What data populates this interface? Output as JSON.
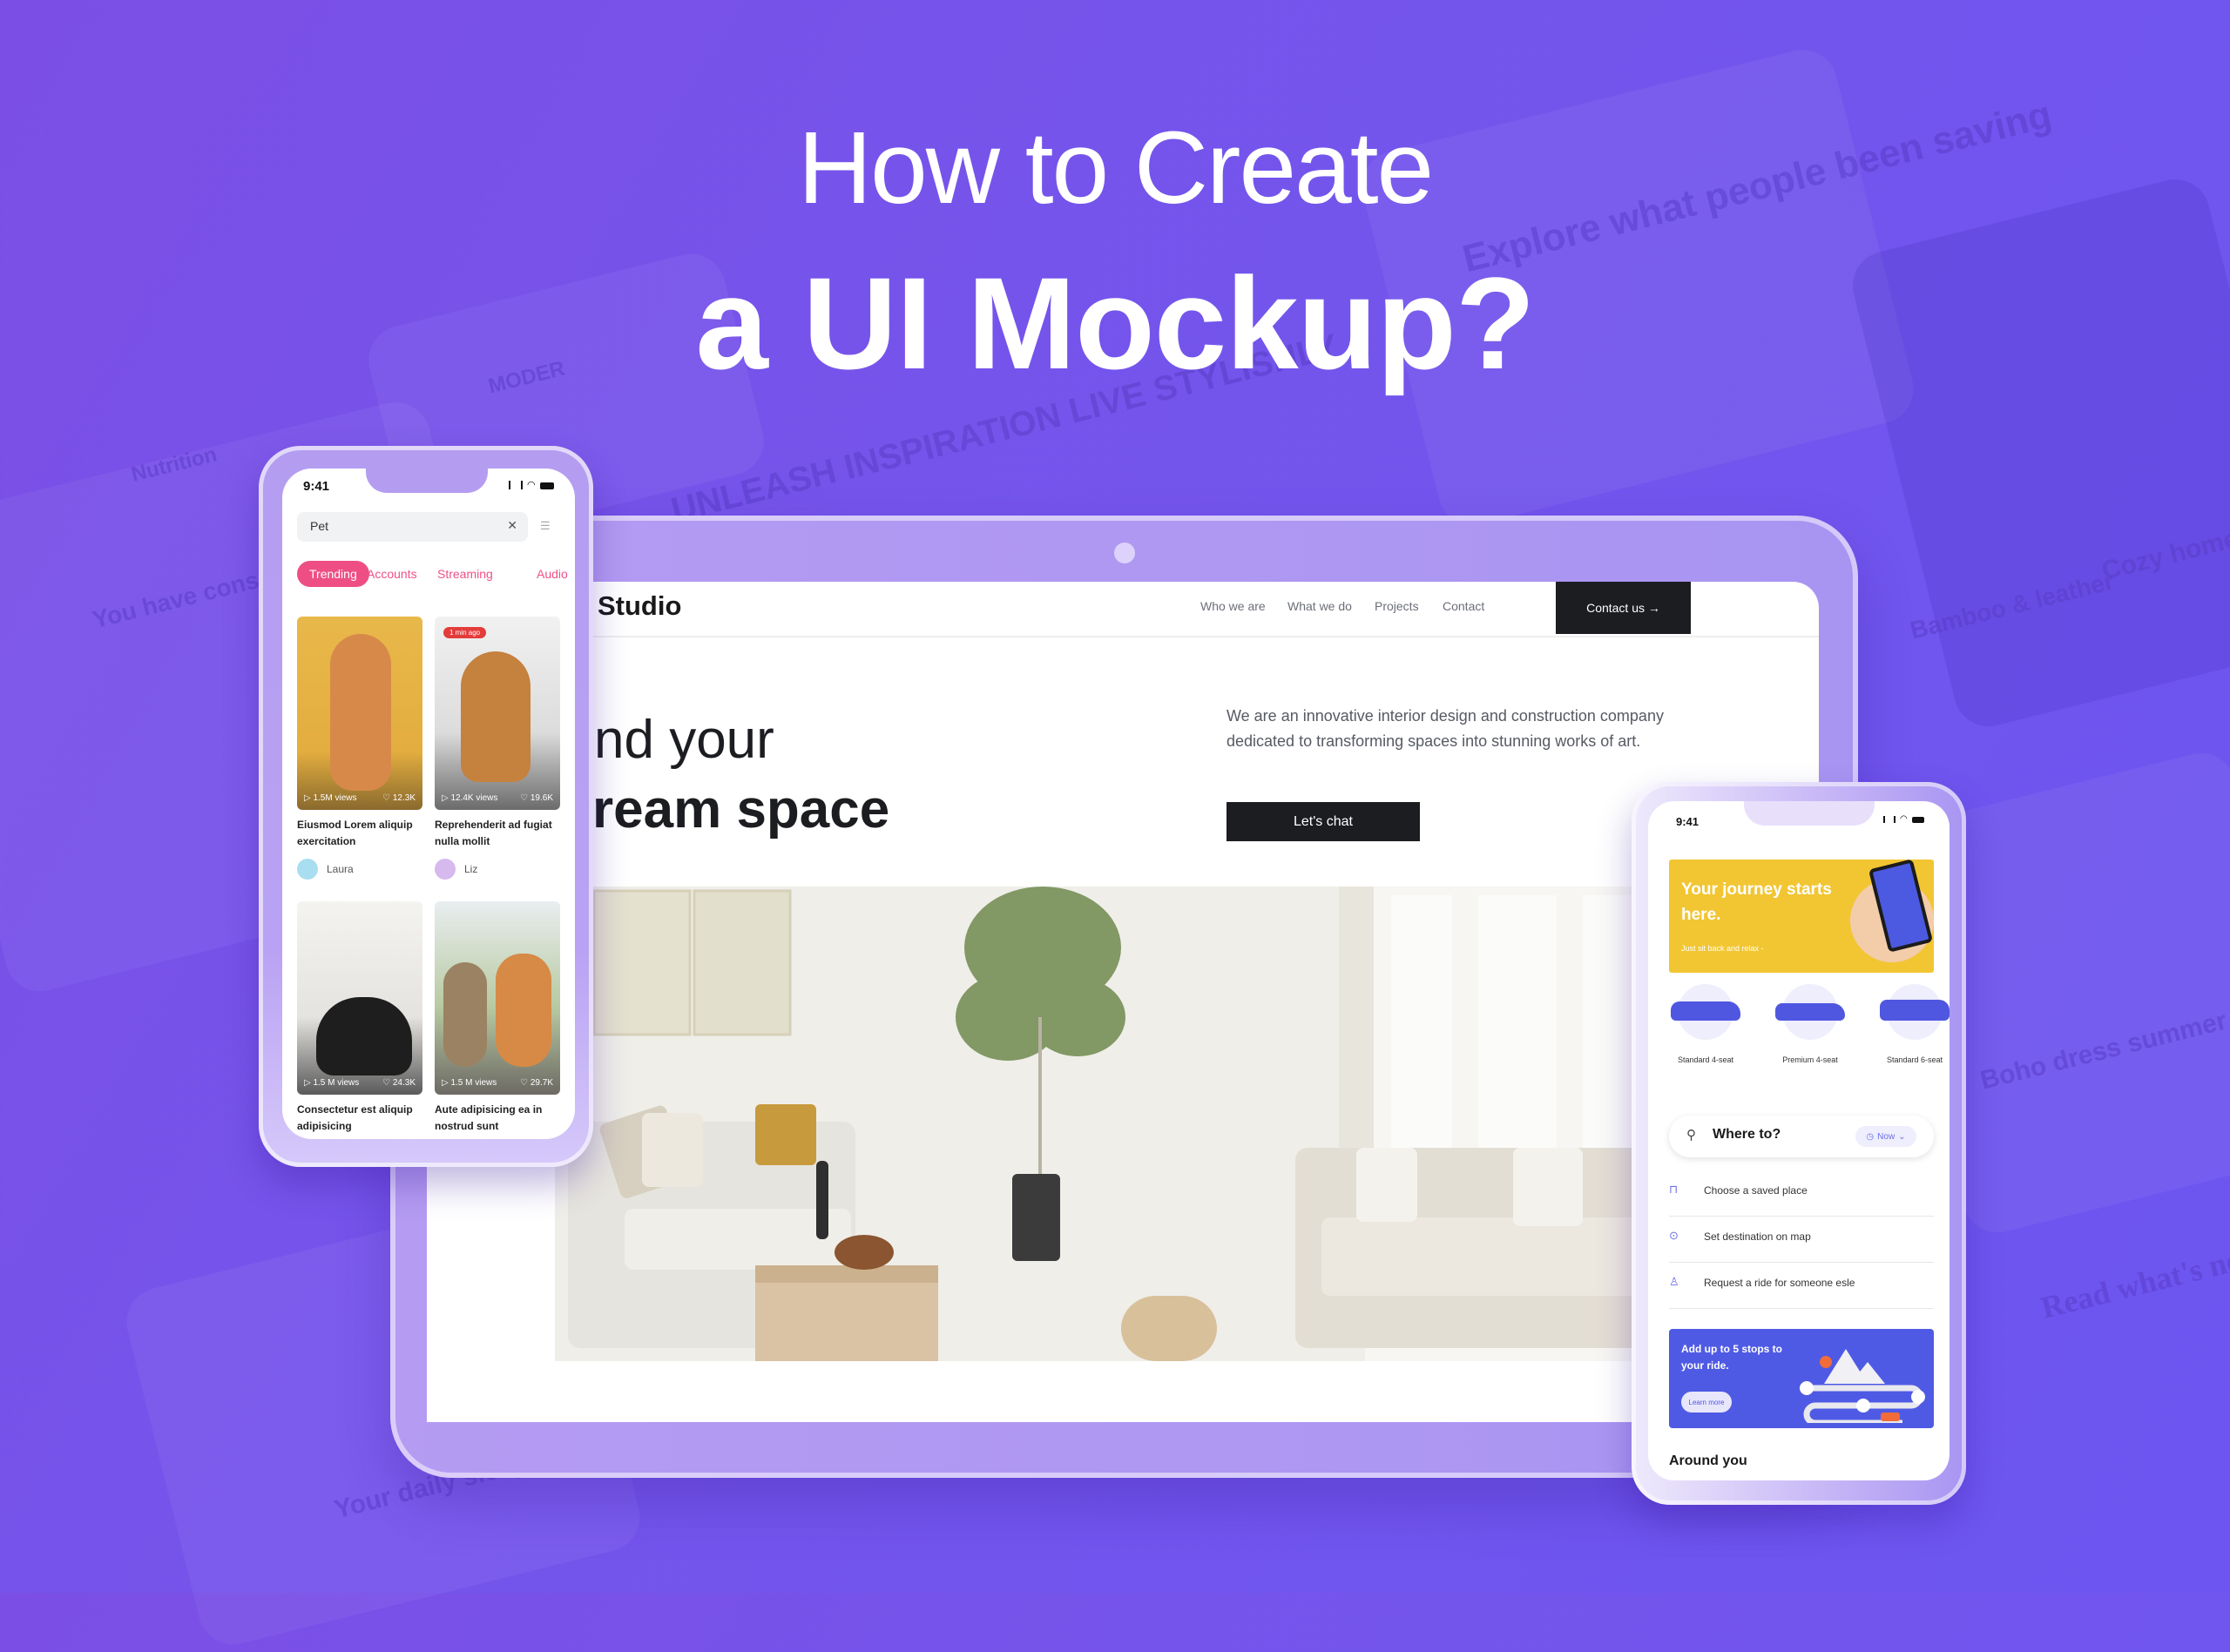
{
  "hero": {
    "line1": "How to Create",
    "line2": "a UI Mockup?"
  },
  "background": {
    "texts": [
      "Explore what people been saving",
      "UNLEASH INSPIRATION LIVE STYLISHLY",
      "MODER",
      "Nutrition",
      "You have consumed 960 kcal today",
      "Cozy home office",
      "Bamboo & leather",
      "Boho dress summer",
      "Read what's new",
      "Your daily sleep a day"
    ],
    "colors": {
      "primary": "#7455ec",
      "accent": "#7b4fe6"
    }
  },
  "website": {
    "brand": "Studio",
    "nav": [
      "Who we are",
      "What we do",
      "Projects",
      "Contact"
    ],
    "contact_button": "Contact us →",
    "headline_line1": "nd your",
    "headline_line2": "ream space",
    "description": "We are an innovative interior design and construction company dedicated to transforming spaces into stunning works of art.",
    "cta": "Let's chat",
    "hero_image": "living-room-photo"
  },
  "pet_app": {
    "time": "9:41",
    "search_value": "Pet",
    "tabs": [
      "Trending",
      "Accounts",
      "Streaming",
      "Audio"
    ],
    "active_tab": "Trending",
    "cards": [
      {
        "views": "▷ 1.5M views",
        "likes": "♡ 12.3K",
        "title": "Eiusmod Lorem aliquip exercitation",
        "author": "Laura",
        "badge": "",
        "bg": "#e9b84a"
      },
      {
        "views": "▷ 12.4K views",
        "likes": "♡ 19.6K",
        "title": "Reprehenderit ad fugiat nulla mollit",
        "author": "Liz",
        "badge": "1 min ago",
        "bg": "#d9d9d9"
      },
      {
        "views": "▷ 1.5 M views",
        "likes": "♡ 24.3K",
        "title": "Consectetur est aliquip adipisicing",
        "author": "",
        "badge": "",
        "bg": "#ecebe8"
      },
      {
        "views": "▷ 1.5 M views",
        "likes": "♡ 29.7K",
        "title": "Aute adipisicing ea in nostrud sunt",
        "author": "",
        "badge": "",
        "bg": "#cfe0c6"
      }
    ]
  },
  "ride_app": {
    "time": "9:41",
    "promo_title": "Your journey starts here.",
    "promo_subtitle": "Just sit back and relax -",
    "vehicles": [
      "Standard 4-seat",
      "Premium 4-seat",
      "Standard 6-seat"
    ],
    "search_placeholder": "Where to?",
    "time_pill": "Now",
    "options": [
      {
        "icon": "bookmark-icon",
        "label": "Choose a saved place"
      },
      {
        "icon": "location-pin-icon",
        "label": "Set destination on map"
      },
      {
        "icon": "person-add-icon",
        "label": "Request a ride for someone esle"
      }
    ],
    "stops_banner": "Add up to 5 stops to your ride.",
    "learn_more": "Learn more",
    "section_title": "Around you"
  }
}
